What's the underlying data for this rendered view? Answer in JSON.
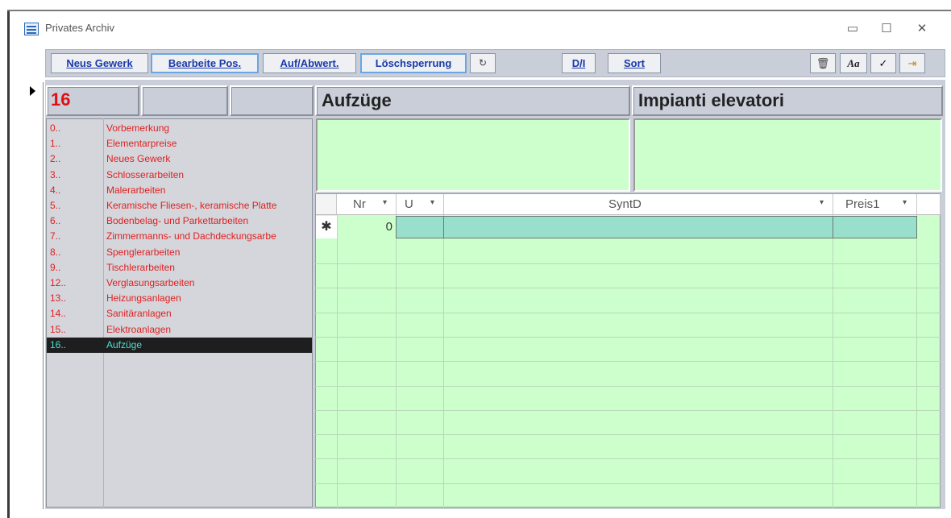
{
  "window": {
    "title": "Privates Archiv",
    "controls": [
      "▭",
      "☐",
      "✕"
    ]
  },
  "toolbar": {
    "neus_gewerk": "Neus Gewerk",
    "bearbeite_pos": "Bearbeite Pos.",
    "auf_abwert": "Auf/Abwert.",
    "loeschsperrung": "Löschsperrung",
    "d_i": "D/I",
    "sort": "Sort",
    "aa": "Aa",
    "check": "✓"
  },
  "record": {
    "code": "16",
    "header_de": "Aufzüge",
    "header_it": "Impianti elevatori"
  },
  "list": [
    {
      "code": "0..",
      "name": "Vorbemerkung"
    },
    {
      "code": "1..",
      "name": "Elementarpreise"
    },
    {
      "code": "2..",
      "name": "Neues Gewerk"
    },
    {
      "code": "3..",
      "name": "Schlosserarbeiten"
    },
    {
      "code": "4..",
      "name": "Malerarbeiten"
    },
    {
      "code": "5..",
      "name": "Keramische Fliesen-, keramische Platte"
    },
    {
      "code": "6..",
      "name": "Bodenbelag- und Parkettarbeiten"
    },
    {
      "code": "7..",
      "name": "Zimmermanns- und Dachdeckungsarbe"
    },
    {
      "code": "8..",
      "name": "Spenglerarbeiten"
    },
    {
      "code": "9..",
      "name": "Tischlerarbeiten"
    },
    {
      "code": "12..",
      "name": "Verglasungsarbeiten"
    },
    {
      "code": "13..",
      "name": "Heizungsanlagen"
    },
    {
      "code": "14..",
      "name": "Sanitäranlagen"
    },
    {
      "code": "15..",
      "name": "Elektroanlagen"
    },
    {
      "code": "16..",
      "name": "Aufzüge"
    }
  ],
  "grid": {
    "columns": [
      "Nr",
      "U",
      "SyntD",
      "Preis1"
    ],
    "dropdown": "▾",
    "new_row_marker": "✱",
    "new_row_nr": "0"
  }
}
